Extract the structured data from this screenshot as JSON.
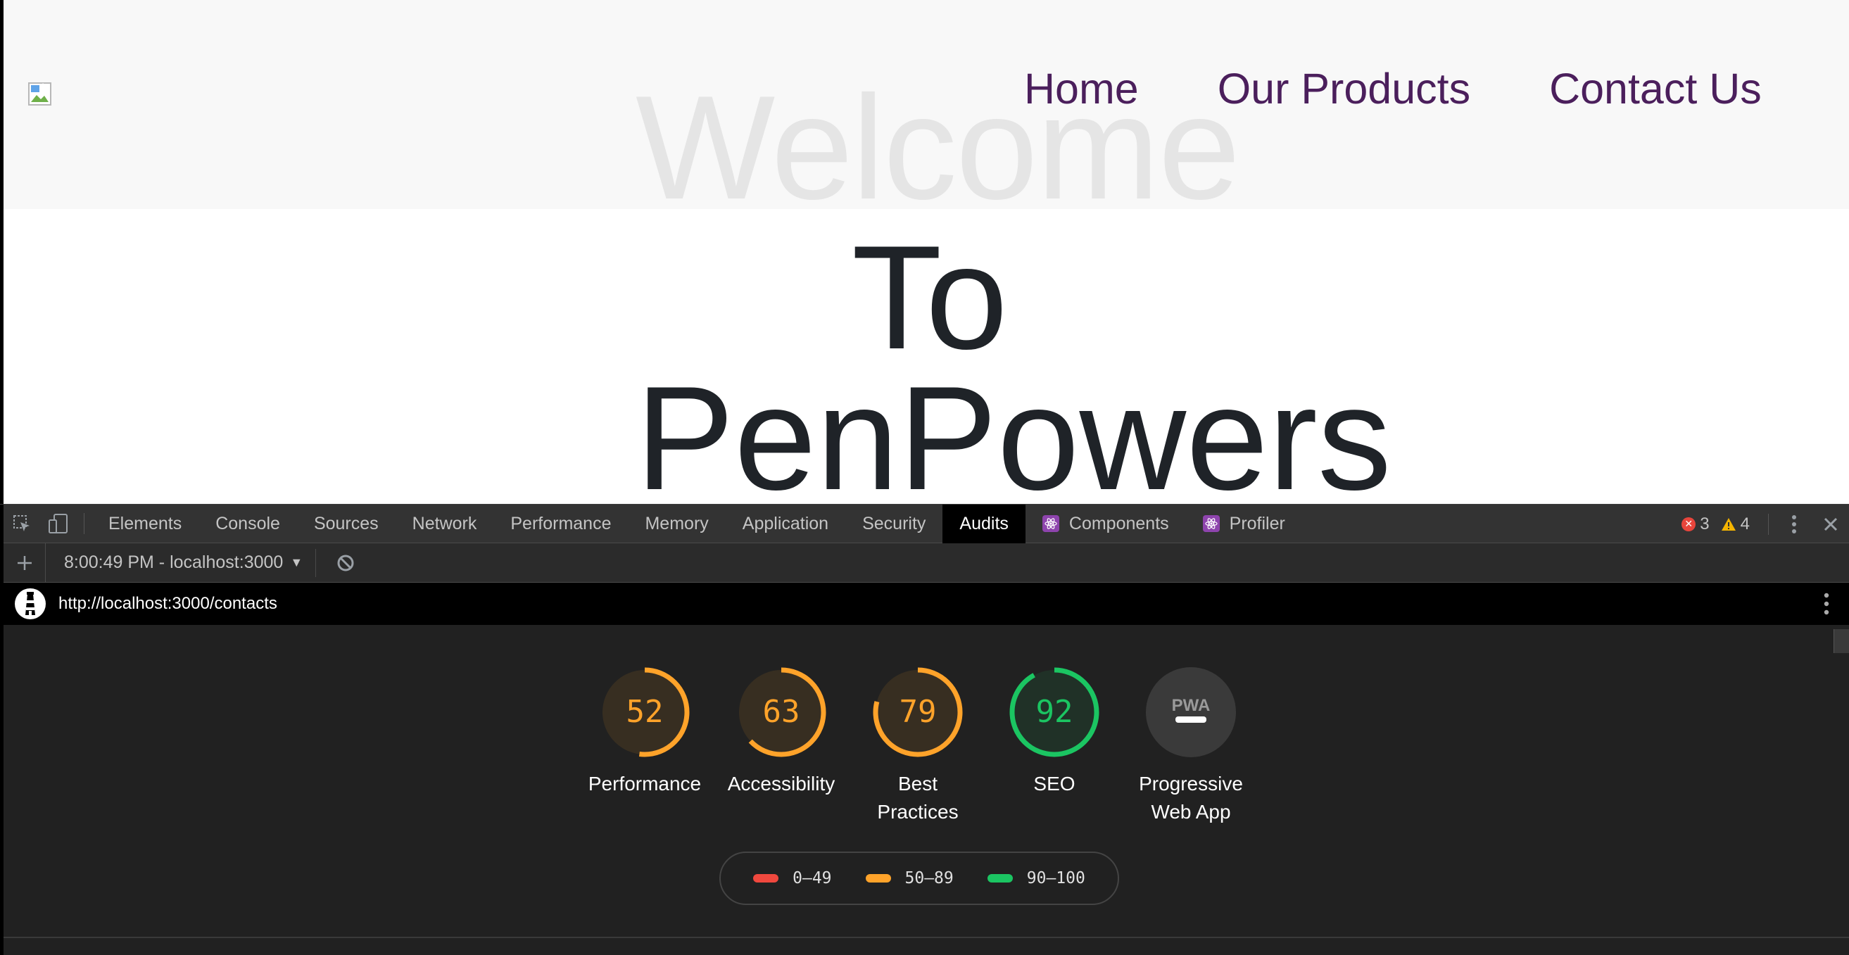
{
  "site": {
    "nav": [
      "Home",
      "Our Products",
      "Contact Us"
    ],
    "hero": {
      "line1": "Welcome",
      "line2": "To",
      "line3": "PenPowers"
    }
  },
  "devtools": {
    "tabs": [
      "Elements",
      "Console",
      "Sources",
      "Network",
      "Performance",
      "Memory",
      "Application",
      "Security",
      "Audits",
      "Components",
      "Profiler"
    ],
    "active_tab": "Audits",
    "error_count": "3",
    "warning_count": "4",
    "report_selector": "8:00:49 PM - localhost:3000",
    "url": "http://localhost:3000/contacts",
    "scores": [
      {
        "label": "Performance",
        "score": 52,
        "color": "#ffa32a"
      },
      {
        "label": "Accessibility",
        "score": 63,
        "color": "#ffa32a"
      },
      {
        "label": "Best Practices",
        "score": 79,
        "color": "#ffa32a"
      },
      {
        "label": "SEO",
        "score": 92,
        "color": "#1bc562"
      }
    ],
    "pwa": {
      "label": "Progressive Web App",
      "badge": "PWA"
    },
    "legend": [
      {
        "range": "0–49",
        "color": "#f0483e"
      },
      {
        "range": "50–89",
        "color": "#ffa32a"
      },
      {
        "range": "90–100",
        "color": "#1bc562"
      }
    ]
  }
}
